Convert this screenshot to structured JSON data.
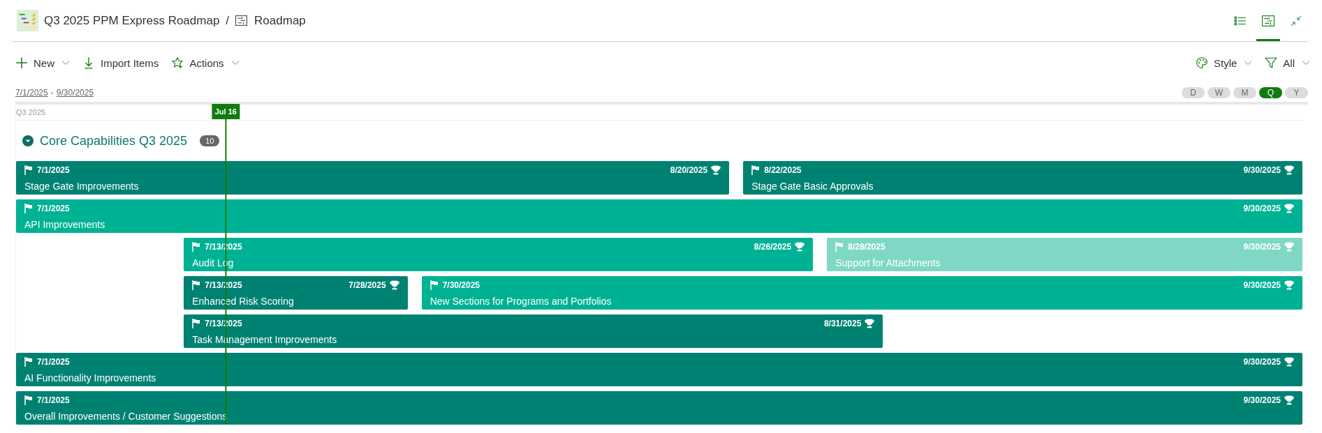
{
  "header": {
    "project": "Q3 2025 PPM Express Roadmap",
    "separator": "/",
    "page": "Roadmap",
    "views": [
      {
        "kind": "list",
        "selected": false
      },
      {
        "kind": "roadmap",
        "selected": true
      },
      {
        "kind": "collapse",
        "selected": false
      }
    ]
  },
  "toolbar": {
    "left": [
      {
        "kind": "plus",
        "label": "New",
        "dropdown": true
      },
      {
        "kind": "import",
        "label": "Import Items",
        "dropdown": false
      },
      {
        "kind": "star",
        "label": "Actions",
        "dropdown": true
      }
    ],
    "right": [
      {
        "kind": "palette",
        "label": "Style",
        "dropdown": true
      },
      {
        "kind": "filter",
        "label": "All",
        "dropdown": true
      }
    ]
  },
  "range": {
    "start": "7/1/2025",
    "dash": "-",
    "end": "9/30/2025"
  },
  "scales": [
    {
      "label": "D",
      "selected": false
    },
    {
      "label": "W",
      "selected": false
    },
    {
      "label": "M",
      "selected": false
    },
    {
      "label": "Q",
      "selected": true
    },
    {
      "label": "Y",
      "selected": false
    }
  ],
  "timeline": {
    "period": "Q3 2025",
    "today": "Jul 16"
  },
  "group": {
    "title": "Core Capabilities Q3 2025",
    "count": "10",
    "expanded": true,
    "lanes": [
      [
        {
          "start": "7/1/2025",
          "end": "8/20/2025",
          "name": "Stage Gate Improvements",
          "color": "#008272"
        },
        {
          "start": "8/22/2025",
          "end": "9/30/2025",
          "name": "Stage Gate Basic Approvals",
          "color": "#008272"
        }
      ],
      [
        {
          "start": "7/1/2025",
          "end": "9/30/2025",
          "name": "API Improvements",
          "color": "#00b294"
        }
      ],
      [
        {
          "start": "7/13/2025",
          "end": "8/26/2025",
          "name": "Audit Log",
          "color": "#00b294"
        },
        {
          "start": "8/28/2025",
          "end": "9/30/2025",
          "name": "Support for Attachments",
          "color": "#7fd8c6"
        }
      ],
      [
        {
          "start": "7/13/2025",
          "end": "7/28/2025",
          "name": "Enhanced Risk Scoring",
          "color": "#008272"
        },
        {
          "start": "7/30/2025",
          "end": "9/30/2025",
          "name": "New Sections for Programs and Portfolios",
          "color": "#00b294"
        }
      ],
      [
        {
          "start": "7/13/2025",
          "end": "8/31/2025",
          "name": "Task Management Improvements",
          "color": "#008272"
        }
      ],
      [
        {
          "start": "7/1/2025",
          "end": "9/30/2025",
          "name": "AI Functionality Improvements",
          "color": "#008272"
        }
      ],
      [
        {
          "start": "7/1/2025",
          "end": "9/30/2025",
          "name": "Overall Improvements / Customer Suggestions",
          "color": "#008272"
        }
      ]
    ]
  }
}
